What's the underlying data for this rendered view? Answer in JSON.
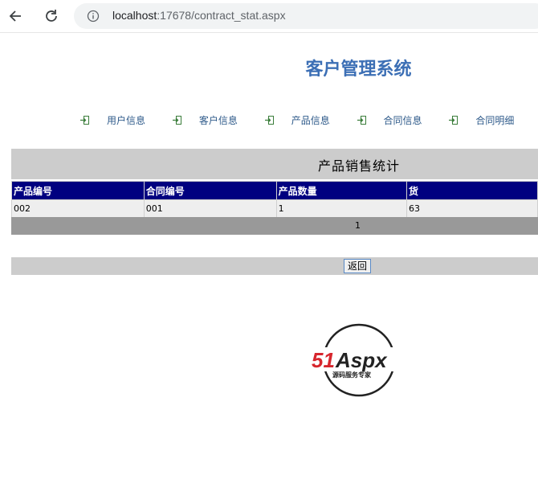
{
  "browser": {
    "url_host": "localhost",
    "url_rest": ":17678/contract_stat.aspx"
  },
  "site": {
    "title": "客户管理系统"
  },
  "menu": [
    {
      "label": "用户信息"
    },
    {
      "label": "客户信息"
    },
    {
      "label": "产品信息"
    },
    {
      "label": "合同信息"
    },
    {
      "label": "合同明细"
    }
  ],
  "panel": {
    "title": "产品销售统计"
  },
  "table": {
    "headers": [
      "产品编号",
      "合同编号",
      "产品数量",
      "货"
    ],
    "rows": [
      [
        "002",
        "001",
        "1",
        "63"
      ]
    ]
  },
  "pager": {
    "page": "1"
  },
  "footer": {
    "back_label": "返回"
  },
  "logo": {
    "brand_51": "51",
    "brand_aspx": "Aspx",
    "tagline": "源码服务专家",
    "colors": {
      "red": "#d7262d",
      "green": "#3a9a3a",
      "black": "#222222"
    }
  }
}
